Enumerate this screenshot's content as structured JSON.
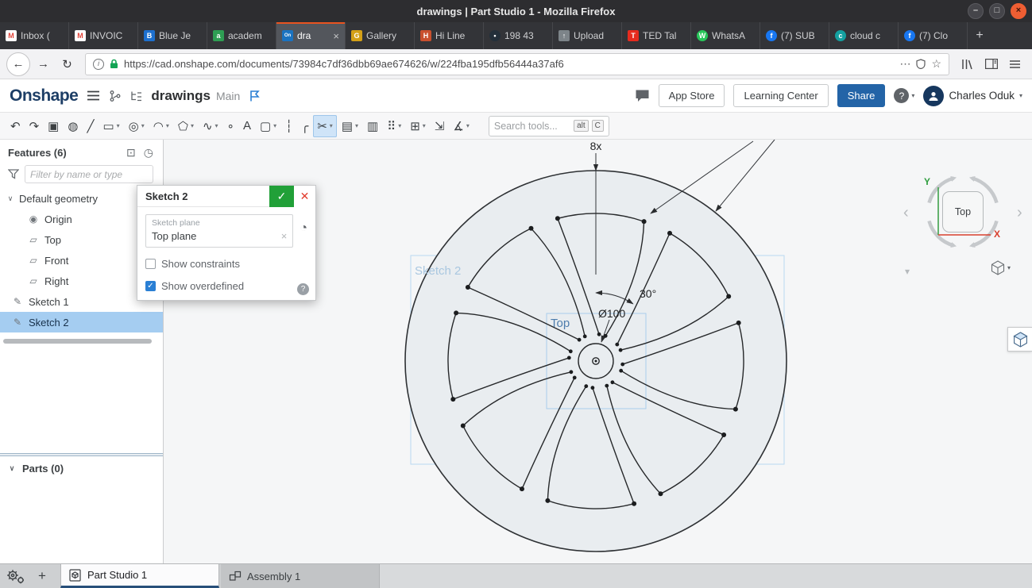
{
  "window": {
    "title": "drawings | Part Studio 1 - Mozilla Firefox",
    "controls": [
      {
        "name": "minimize",
        "glyph": "–"
      },
      {
        "name": "maximize",
        "glyph": "□"
      },
      {
        "name": "close",
        "glyph": "×"
      }
    ]
  },
  "browser": {
    "new_tab_glyph": "+",
    "tabs": [
      {
        "label": "Inbox (",
        "icon": "gmail"
      },
      {
        "label": "INVOIC",
        "icon": "gmail"
      },
      {
        "label": "Blue Je",
        "icon": "bluejeans"
      },
      {
        "label": "academ",
        "icon": "academia"
      },
      {
        "label": "dra",
        "icon": "onshape",
        "active": true
      },
      {
        "label": "Gallery",
        "icon": "gallery"
      },
      {
        "label": "Hi Line",
        "icon": "hiline"
      },
      {
        "label": "198 43",
        "icon": "phone"
      },
      {
        "label": "Upload",
        "icon": "upload"
      },
      {
        "label": "TED Tal",
        "icon": "ted"
      },
      {
        "label": "WhatsA",
        "icon": "whatsapp"
      },
      {
        "label": "(7) SUB",
        "icon": "facebook"
      },
      {
        "label": "cloud c",
        "icon": "cloud"
      },
      {
        "label": "(7) Clo",
        "icon": "facebook"
      }
    ],
    "nav": {
      "url": "https://cad.onshape.com/documents/73984c7df36dbb69ae674626/w/224fba195dfb56444a37af6",
      "icons": {
        "back": "←",
        "forward": "→",
        "refresh": "↻",
        "info": "i",
        "dots": "⋯",
        "star": "☆"
      }
    }
  },
  "header": {
    "logo": "Onshape",
    "doc_title": "drawings",
    "workspace": "Main",
    "buttons": {
      "app_store": "App Store",
      "learning": "Learning Center",
      "share": "Share"
    },
    "help_glyph": "?",
    "user": "Charles Oduk"
  },
  "toolbar": {
    "search_placeholder": "Search tools...",
    "kbd": [
      "alt",
      "C"
    ],
    "caret_glyph": "▾",
    "tools": [
      {
        "name": "undo-icon",
        "glyph": "↶"
      },
      {
        "name": "redo-icon",
        "glyph": "↷"
      },
      {
        "name": "copy-icon",
        "glyph": "▣"
      },
      {
        "name": "sphere-icon",
        "glyph": "◍"
      },
      {
        "name": "line-icon",
        "glyph": "╱"
      },
      {
        "name": "rectangle-icon",
        "glyph": "▭",
        "caret": true
      },
      {
        "name": "circle-icon",
        "glyph": "◎",
        "caret": true
      },
      {
        "name": "arc-icon",
        "glyph": "◠",
        "caret": true
      },
      {
        "name": "polygon-icon",
        "glyph": "⬠",
        "caret": true
      },
      {
        "name": "spline-icon",
        "glyph": "∿",
        "caret": true
      },
      {
        "name": "point-icon",
        "glyph": "∘"
      },
      {
        "name": "text-icon",
        "glyph": "A"
      },
      {
        "name": "slot-icon",
        "glyph": "▢",
        "caret": true
      },
      {
        "name": "construction-icon",
        "glyph": "┆"
      },
      {
        "name": "fillet-icon",
        "glyph": "╭"
      },
      {
        "name": "trim-icon",
        "glyph": "✂",
        "caret": true,
        "active": true
      },
      {
        "name": "offset-icon",
        "glyph": "▤",
        "caret": true
      },
      {
        "name": "ruler-icon",
        "glyph": "▥"
      },
      {
        "name": "pattern-icon",
        "glyph": "⠿",
        "caret": true
      },
      {
        "name": "image-icon",
        "glyph": "⊞",
        "caret": true
      },
      {
        "name": "fit-icon",
        "glyph": "⇲"
      },
      {
        "name": "measure-icon",
        "glyph": "∡",
        "caret": true
      }
    ]
  },
  "features_panel": {
    "title": "Features (6)",
    "header_icons": {
      "display": "⊡",
      "history": "◷"
    },
    "filter_placeholder": "Filter by name or type",
    "glyphs": {
      "caret": "∨",
      "origin": "◉",
      "plane": "▱",
      "sketch": "✎"
    },
    "tree": [
      {
        "label": "Default geometry",
        "type": "group"
      },
      {
        "label": "Origin",
        "icon": "origin",
        "type": "child"
      },
      {
        "label": "Top",
        "icon": "plane",
        "type": "child"
      },
      {
        "label": "Front",
        "icon": "plane",
        "type": "child"
      },
      {
        "label": "Right",
        "icon": "plane",
        "type": "child"
      },
      {
        "label": "Sketch 1",
        "icon": "sketch",
        "type": "item"
      },
      {
        "label": "Sketch 2",
        "icon": "sketch",
        "type": "item",
        "selected": true
      }
    ],
    "parts_title": "Parts (0)"
  },
  "dialog": {
    "title": "Sketch 2",
    "plane_label": "Sketch plane",
    "plane_value": "Top plane",
    "checkboxes": [
      {
        "label": "Show constraints",
        "checked": false
      },
      {
        "label": "Show overdefined",
        "checked": true
      }
    ],
    "icons": {
      "check": "✓",
      "close": "✕",
      "clear": "×",
      "clock": "◔",
      "help": "?"
    }
  },
  "canvas": {
    "count_label": "8x",
    "angle_label": "30°",
    "diameter_label": "Ø100",
    "sketch_label": "Sketch 2",
    "plane_label": "Top"
  },
  "view_cube": {
    "face": "Top",
    "axis_x": "X",
    "axis_y": "Y",
    "chev_left": "‹",
    "chev_right": "›",
    "caret_down": "▾"
  },
  "bottom_bar": {
    "plus_glyph": "+",
    "tabs": [
      {
        "label": "Part Studio 1",
        "active": true
      },
      {
        "label": "Assembly 1",
        "active": false
      }
    ]
  },
  "colors": {
    "accent_blue": "#2364a7",
    "selection_blue": "#a5cdf1",
    "check_green": "#21a038",
    "close_red": "#e23d2e",
    "ubuntu_orange": "#e95420",
    "lock_green": "#12a454"
  }
}
